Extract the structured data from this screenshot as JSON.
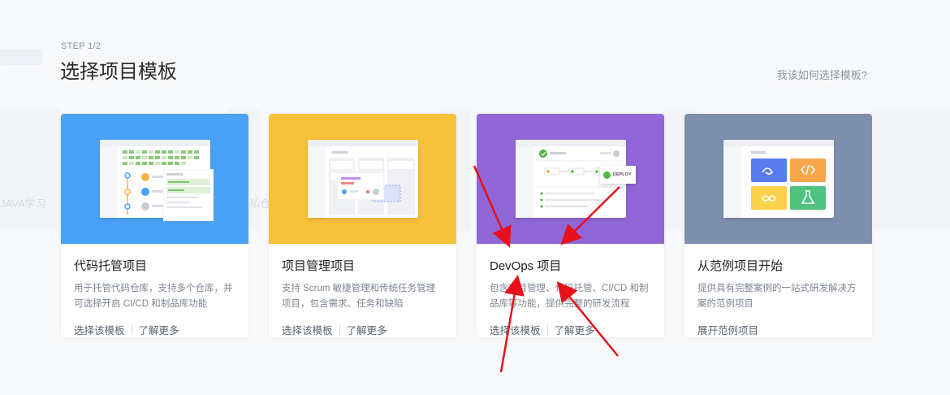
{
  "header": {
    "step": "STEP 1/2",
    "title": "选择项目模板",
    "help_link": "我该如何选择模板?"
  },
  "background": {
    "ghost_label_1": "JAVA学习",
    "ghost_label_2": "私仓"
  },
  "cards": [
    {
      "title": "代码托管项目",
      "desc": "用于托管代码仓库，支持多个仓库，并可选择开启 CI/CD 和制品库功能",
      "action_primary": "选择该模板",
      "action_secondary": "了解更多",
      "color": "#4aa2f7"
    },
    {
      "title": "项目管理项目",
      "desc": "支持 Scrum 敏捷管理和传统任务管理项目，包含需求、任务和缺陷",
      "action_primary": "选择该模板",
      "action_secondary": "了解更多",
      "color": "#f8c13c"
    },
    {
      "title": "DevOps 项目",
      "desc": "包含项目管理、代码托管、CI/CD 和制品库等功能，提供完整的研发流程",
      "action_primary": "选择该模板",
      "action_secondary": "了解更多",
      "color": "#9167d8",
      "badge": "DEPLOY"
    },
    {
      "title": "从范例项目开始",
      "desc": "提供具有完整案例的一站式研发解决方案的范例项目",
      "action_primary": "展开范例项目",
      "color": "#7d8fad"
    }
  ],
  "annotation_color": "#e8101a"
}
